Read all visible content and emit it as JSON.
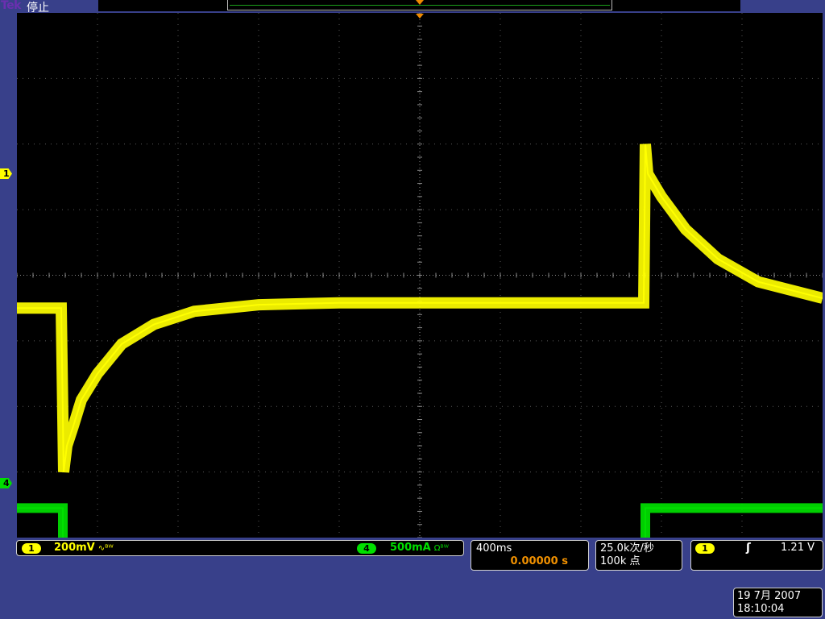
{
  "status": {
    "brand": "Tek",
    "run_state": "停止"
  },
  "channels": {
    "ch1": {
      "marker": "1",
      "scale": "200mV",
      "coupling_icon": "∿ᴮᵂ",
      "color": "#ffff00"
    },
    "ch4": {
      "marker": "4",
      "scale": "500mA",
      "coupling_icon": "Ωᴮᵂ",
      "color": "#00e000"
    }
  },
  "timebase": {
    "scale": "400ms",
    "position": "0.00000 s",
    "position_color": "#f09000"
  },
  "acquisition": {
    "sample_rate": "25.0k次/秒",
    "record_length": "100k 点"
  },
  "trigger": {
    "source": "1",
    "slope_icon": "rising-edge-icon",
    "slope_glyph": "ʃ",
    "level": "1.21 V"
  },
  "clock": {
    "date": "19 7月  2007",
    "time": "18:10:04"
  },
  "graticule": {
    "h_divisions": 10,
    "v_divisions": 8,
    "minor_per_div": 5
  },
  "chart_data": {
    "type": "line",
    "x_unit": "div",
    "series": [
      {
        "name": "1",
        "color": "#ffff00",
        "x": [
          0,
          0.55,
          0.58,
          0.62,
          0.7,
          0.8,
          1.0,
          1.3,
          1.7,
          2.2,
          3.0,
          4.0,
          5.0,
          6.0,
          7.0,
          7.78,
          7.8,
          7.83,
          8.0,
          8.3,
          8.7,
          9.2,
          10.0
        ],
        "y": [
          -0.5,
          -0.5,
          -3.0,
          -2.6,
          -2.3,
          -1.9,
          -1.5,
          -1.05,
          -0.75,
          -0.55,
          -0.45,
          -0.42,
          -0.42,
          -0.42,
          -0.42,
          -0.42,
          2.0,
          1.55,
          1.2,
          0.7,
          0.25,
          -0.1,
          -0.35
        ]
      },
      {
        "name": "4",
        "color": "#00e000",
        "x": [
          0,
          0.57,
          0.57,
          7.8,
          7.8,
          10.0
        ],
        "y": [
          -3.55,
          -3.55,
          -4.5,
          -4.5,
          -3.55,
          -3.55
        ]
      }
    ]
  }
}
